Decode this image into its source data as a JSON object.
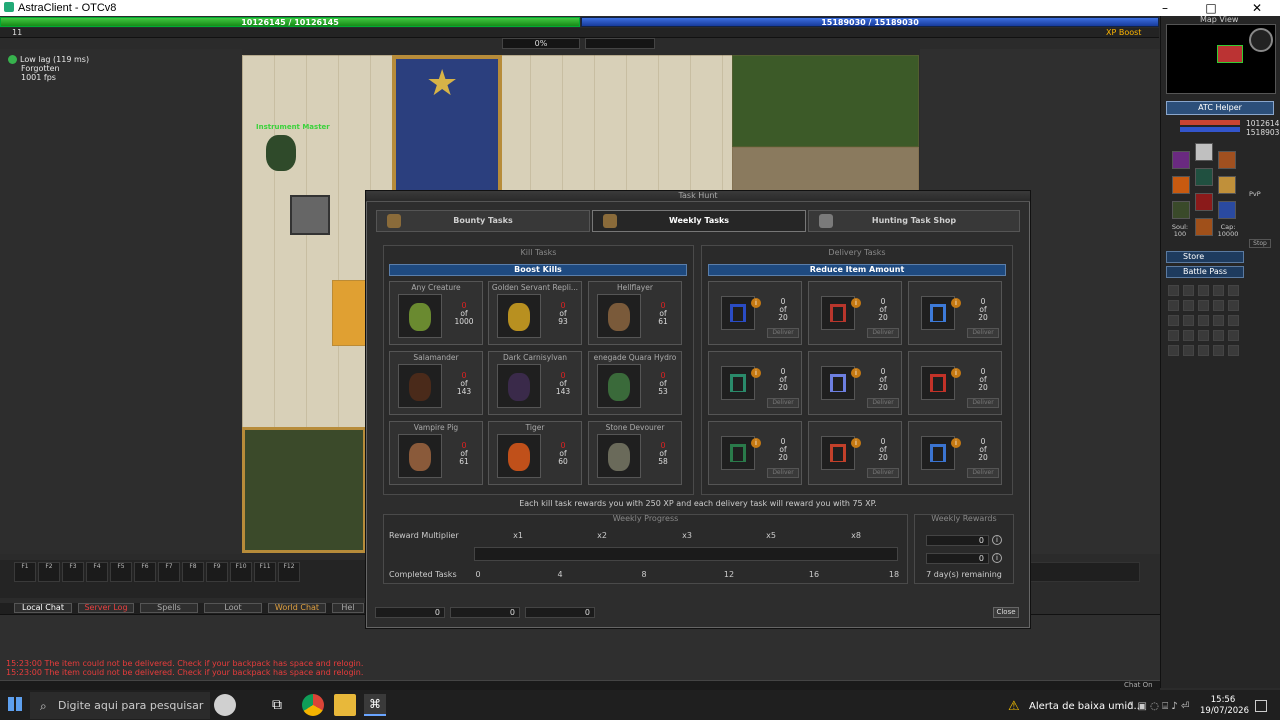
{
  "window": {
    "title": "AstraClient - OTCv8"
  },
  "bars": {
    "health": "10126145 / 10126145",
    "mana": "15189030 / 15189030",
    "level": "11",
    "xp_percent": "0%",
    "xp_boost": "XP Boost"
  },
  "status": {
    "lag": "Low lag (119 ms)",
    "server": "Forgotten",
    "fps": "1001 fps"
  },
  "map": {
    "npc_name": "Instrument Master"
  },
  "sidebar": {
    "map_view": "Map View",
    "atc_helper": "ATC Helper",
    "hp_value": "1012614",
    "mp_value": "1518903",
    "soul_label": "Soul:",
    "soul_value": "100",
    "cap_label": "Cap:",
    "cap_value": "10000",
    "stop": "Stop",
    "store": "Store",
    "battle_pass": "Battle Pass",
    "pvp": "PvP"
  },
  "hotkeys": [
    "F1",
    "F2",
    "F3",
    "F4",
    "F5",
    "F6",
    "F7",
    "F8",
    "F9",
    "F10",
    "F11",
    "F12"
  ],
  "chat": {
    "tabs": [
      "Local Chat",
      "Server Log",
      "Spells",
      "Loot",
      "World Chat",
      "Hel"
    ],
    "messages": [
      "15:23:00 The item could not be delivered. Check if your backpack has space and relogin.",
      "15:23:00 The item could not be delivered. Check if your backpack has space and relogin."
    ],
    "chat_on": "Chat On"
  },
  "task_hunt": {
    "title": "Task Hunt",
    "tabs": [
      "Bounty Tasks",
      "Weekly Tasks",
      "Hunting Task Shop"
    ],
    "kill_tasks": {
      "header": "Kill Tasks",
      "boost": "Boost Kills",
      "cards": [
        {
          "name": "Any Creature",
          "progress": "0",
          "of": "of",
          "total": "1000"
        },
        {
          "name": "Golden Servant Repli...",
          "progress": "0",
          "of": "of",
          "total": "93"
        },
        {
          "name": "Hellflayer",
          "progress": "0",
          "of": "of",
          "total": "61"
        },
        {
          "name": "Salamander",
          "progress": "0",
          "of": "of",
          "total": "143"
        },
        {
          "name": "Dark Carnisylvan",
          "progress": "0",
          "of": "of",
          "total": "143"
        },
        {
          "name": "enegade Quara Hydro",
          "progress": "0",
          "of": "of",
          "total": "53"
        },
        {
          "name": "Vampire Pig",
          "progress": "0",
          "of": "of",
          "total": "61"
        },
        {
          "name": "Tiger",
          "progress": "0",
          "of": "of",
          "total": "60"
        },
        {
          "name": "Stone Devourer",
          "progress": "0",
          "of": "of",
          "total": "58"
        }
      ]
    },
    "delivery_tasks": {
      "header": "Delivery Tasks",
      "reduce": "Reduce Item Amount",
      "deliver": "Deliver",
      "items": [
        {
          "progress": "0",
          "of": "of",
          "total": "20",
          "color": "#2a4cc4"
        },
        {
          "progress": "0",
          "of": "of",
          "total": "20",
          "color": "#b8362c"
        },
        {
          "progress": "0",
          "of": "of",
          "total": "20",
          "color": "#3d7ad8"
        },
        {
          "progress": "0",
          "of": "of",
          "total": "20",
          "color": "#2a8a6a"
        },
        {
          "progress": "0",
          "of": "of",
          "total": "20",
          "color": "#6d7fe0"
        },
        {
          "progress": "0",
          "of": "of",
          "total": "20",
          "color": "#c23228"
        },
        {
          "progress": "0",
          "of": "of",
          "total": "20",
          "color": "#2a7a4a"
        },
        {
          "progress": "0",
          "of": "of",
          "total": "20",
          "color": "#c2402a"
        },
        {
          "progress": "0",
          "of": "of",
          "total": "20",
          "color": "#3b74d0"
        }
      ]
    },
    "reward_text": "Each kill task rewards you with 250 XP and each delivery task will reward you with 75 XP.",
    "weekly_progress": {
      "header": "Weekly Progress",
      "reward_multiplier": "Reward Multiplier",
      "multipliers": [
        "x1",
        "x2",
        "x3",
        "x5",
        "x8"
      ],
      "completed_tasks": "Completed Tasks",
      "ticks": [
        "0",
        "4",
        "8",
        "12",
        "16",
        "18"
      ],
      "progress_fraction": 0
    },
    "weekly_rewards": {
      "header": "Weekly Rewards",
      "value1": "0",
      "value2": "0",
      "remaining": "7 day(s) remaining"
    },
    "bottom_values": [
      "0",
      "0",
      "0"
    ],
    "close": "Close"
  },
  "taskbar": {
    "search_placeholder": "Digite aqui para pesquisar",
    "alert": "Alerta de baixa umid...",
    "time": "15:56",
    "date": "19/07/2026"
  }
}
